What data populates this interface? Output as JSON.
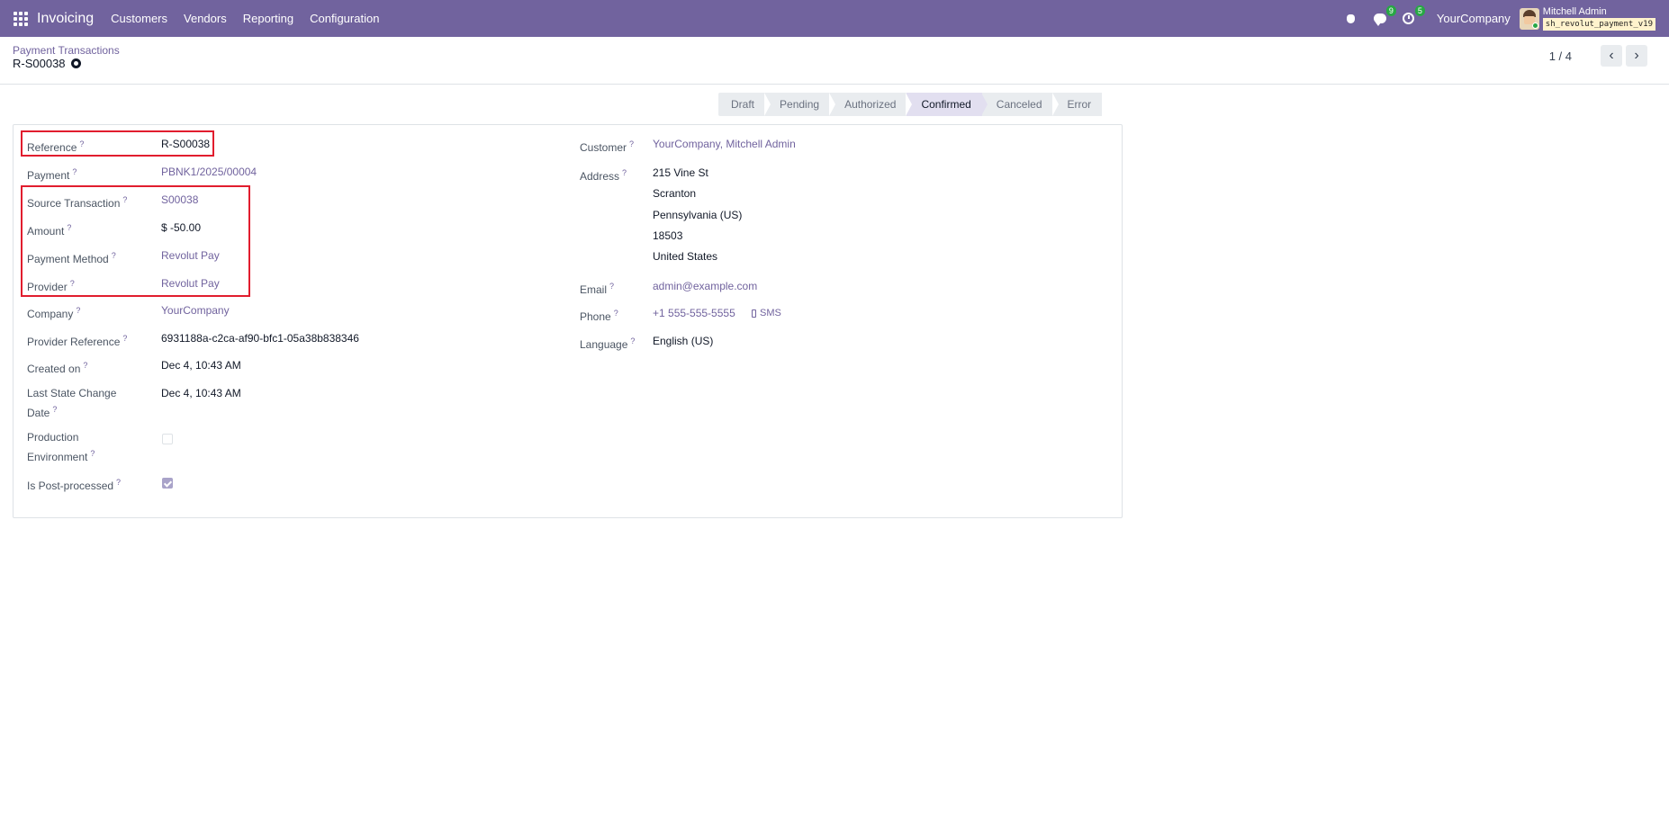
{
  "navbar": {
    "app_name": "Invoicing",
    "menu": [
      "Customers",
      "Vendors",
      "Reporting",
      "Configuration"
    ],
    "messages_count": "9",
    "activities_count": "5",
    "company": "YourCompany",
    "user_name": "Mitchell Admin",
    "database": "sh_revolut_payment_v19"
  },
  "control": {
    "breadcrumb": "Payment Transactions",
    "record_title": "R-S00038",
    "pager": "1 / 4"
  },
  "statusbar": {
    "stages": [
      "Draft",
      "Pending",
      "Authorized",
      "Confirmed",
      "Canceled",
      "Error"
    ],
    "active": "Confirmed"
  },
  "left_fields": {
    "reference": {
      "label": "Reference",
      "value": "R-S00038"
    },
    "payment": {
      "label": "Payment",
      "value": "PBNK1/2025/00004"
    },
    "source_transaction": {
      "label": "Source Transaction",
      "value": "S00038"
    },
    "amount": {
      "label": "Amount",
      "value": "$ -50.00"
    },
    "payment_method": {
      "label": "Payment Method",
      "value": "Revolut Pay"
    },
    "provider": {
      "label": "Provider",
      "value": "Revolut Pay"
    },
    "company": {
      "label": "Company",
      "value": "YourCompany"
    },
    "provider_reference": {
      "label": "Provider Reference",
      "value": "6931188a-c2ca-af90-bfc1-05a38b838346"
    },
    "created_on": {
      "label": "Created on",
      "value": "Dec 4, 10:43 AM"
    },
    "last_state_change_l1": "Last State Change",
    "last_state_change_l2": "Date",
    "last_state_change_value": "Dec 4, 10:43 AM",
    "production_env_l1": "Production",
    "production_env_l2": "Environment",
    "production_env_checked": false,
    "is_post_processed": {
      "label": "Is Post-processed"
    },
    "is_post_processed_checked": true
  },
  "right_fields": {
    "customer": {
      "label": "Customer",
      "value": "YourCompany, Mitchell Admin"
    },
    "address": {
      "label": "Address",
      "lines": [
        "215 Vine St",
        "Scranton",
        "Pennsylvania (US)",
        "18503",
        "United States"
      ]
    },
    "email": {
      "label": "Email",
      "value": "admin@example.com"
    },
    "phone": {
      "label": "Phone",
      "value": "+1 555-555-5555",
      "sms": "SMS"
    },
    "language": {
      "label": "Language",
      "value": "English (US)"
    }
  },
  "help_marker": "?"
}
